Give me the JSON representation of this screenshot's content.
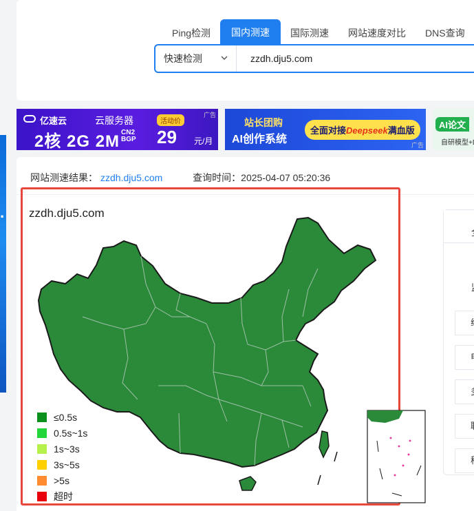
{
  "nav": {
    "tabs": [
      {
        "label": "Ping检测",
        "active": false
      },
      {
        "label": "国内测速",
        "active": true
      },
      {
        "label": "国际测速",
        "active": false
      },
      {
        "label": "网站速度对比",
        "active": false
      },
      {
        "label": "DNS查询",
        "active": false
      }
    ]
  },
  "search": {
    "mode": "快速检测",
    "value": "zzdh.dju5.com"
  },
  "ads": {
    "tag": "广告",
    "ad1": {
      "brand": "亿速云",
      "product": "云服务器",
      "spec": "2核 2G 2M",
      "spec_small": "CN2 BGP",
      "badge": "活动价",
      "price": "29",
      "unit": "元/月"
    },
    "ad2": {
      "line1": "站长团购",
      "line2": "AI创作系统",
      "pill_prefix": "全面对接",
      "pill_highlight": "Deepseek",
      "pill_suffix": "满血版"
    },
    "ad3": {
      "line1": "AI论文",
      "line2": "自研模型+D"
    }
  },
  "result": {
    "label": "网站测速结果：",
    "domain": "zzdh.dju5.com",
    "time_label": "查询时间：",
    "time": "2025-04-07 05:20:36"
  },
  "map": {
    "title": "zzdh.dju5.com",
    "fill_color": "#2a8a3a",
    "legend": [
      {
        "label": "≤0.5s",
        "color": "#0b8f1d"
      },
      {
        "label": "0.5s~1s",
        "color": "#22d63c"
      },
      {
        "label": "1s~3s",
        "color": "#b6f04a"
      },
      {
        "label": "3s~5s",
        "color": "#ffd000"
      },
      {
        "label": ">5s",
        "color": "#ff8c2e"
      },
      {
        "label": "超时",
        "color": "#e8000d"
      }
    ]
  },
  "side_panel": {
    "tab_label": "全",
    "label": "监",
    "rows": [
      "线",
      "电",
      "多",
      "联",
      "移"
    ]
  }
}
